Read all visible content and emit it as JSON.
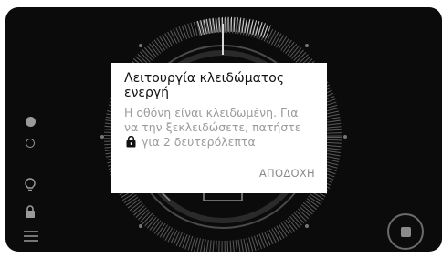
{
  "dialog": {
    "title": "Λειτουργία κλειδώματος ενεργή",
    "body_before_icon": "Η οθόνη είναι κλειδωμένη. Για να την ξεκλειδώσετε, πατήστε",
    "body_after_icon": "για 2 δευτερόλεπτα",
    "accept_label": "ΑΠΟΔΟΧΗ",
    "inline_icon": "lock-icon"
  },
  "side_controls": {
    "icons": [
      "filled-dot-icon",
      "hollow-dot-icon",
      "lightbulb-icon",
      "lock-icon",
      "menu-icon"
    ]
  },
  "stop_button": {
    "icon": "stop-icon"
  },
  "colors": {
    "background": "#0b0b0b",
    "dialog": "#ffffff",
    "muted_text": "#9b9b9b",
    "icon_gray": "#9a9a9a"
  }
}
